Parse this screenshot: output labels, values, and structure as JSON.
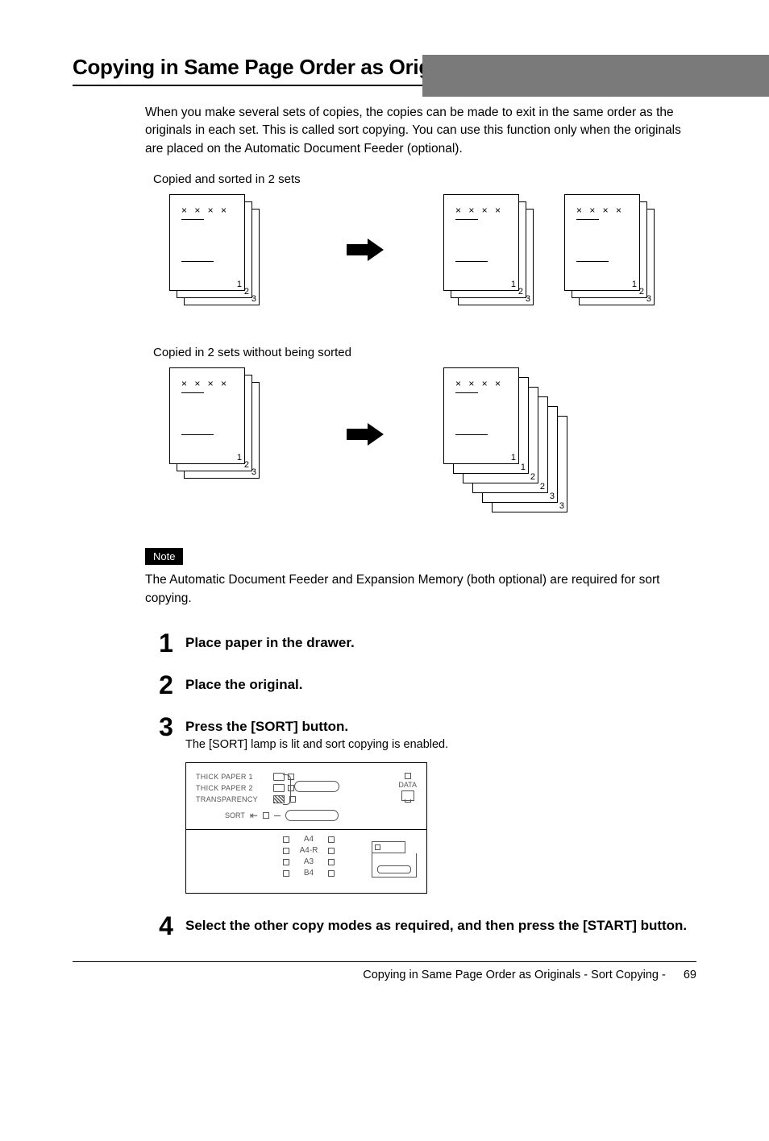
{
  "heading": "Copying in Same Page Order as Originals - Sort Copying -",
  "intro": "When you make several sets of copies, the copies can be made to exit in the same order as the originals in each set. This is called sort copying. You can use this function only when the originals are placed on the Automatic Document Feeder (optional).",
  "diagram1_caption": "Copied and sorted in 2 sets",
  "diagram2_caption": "Copied in 2 sets without being sorted",
  "note_label": "Note",
  "note_text": "The Automatic Document Feeder and Expansion Memory (both optional) are required for sort copying.",
  "steps": {
    "n1": "1",
    "s1_title": "Place paper in the drawer.",
    "n2": "2",
    "s2_title": "Place the original.",
    "n3": "3",
    "s3_title": "Press the [SORT] button.",
    "s3_desc": "The [SORT] lamp is lit and sort copying is enabled.",
    "n4": "4",
    "s4_title": "Select the other copy modes as required, and then press the [START] button."
  },
  "panel": {
    "thick1": "THICK PAPER 1",
    "thick2": "THICK PAPER 2",
    "transparency": "TRANSPARENCY",
    "sort": "SORT",
    "data": "DATA",
    "sizes": {
      "a4": "A4",
      "a4r": "A4-R",
      "a3": "A3",
      "b4": "B4"
    }
  },
  "sheet_marks": "× × × ×",
  "page_labels": {
    "p1": "1",
    "p2": "2",
    "p3": "3"
  },
  "footer_text": "Copying in Same Page Order as Originals - Sort Copying -",
  "footer_page": "69"
}
